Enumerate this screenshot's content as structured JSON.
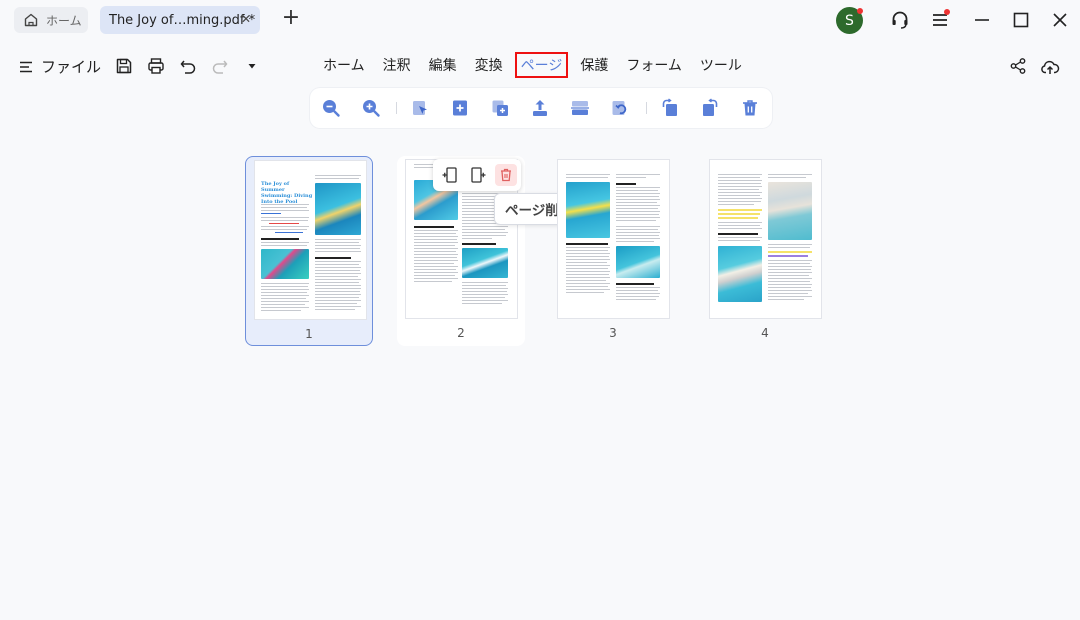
{
  "tabs": {
    "home_label": "ホーム",
    "doc_title": "The Joy of…ming.pdf *"
  },
  "user": {
    "avatar_initial": "S",
    "avatar_color": "#2d6a2c"
  },
  "menubar": {
    "file_label": "ファイル",
    "items": [
      "ホーム",
      "注釈",
      "編集",
      "変換",
      "ページ",
      "保護",
      "フォーム",
      "ツール"
    ],
    "active_index": 4
  },
  "page_tools": {
    "icons": [
      "zoom-out-icon",
      "zoom-in-icon",
      "select-page-icon",
      "insert-page-icon",
      "extract-page-icon",
      "export-page-icon",
      "split-page-icon",
      "replace-page-icon",
      "rotate-left-icon",
      "rotate-right-icon",
      "delete-page-icon"
    ]
  },
  "thumbnails": [
    {
      "number": "1",
      "selected": true,
      "title": "The Joy of Summer Swimming: Diving Into the Pool"
    },
    {
      "number": "2",
      "selected": false
    },
    {
      "number": "3",
      "selected": false
    },
    {
      "number": "4",
      "selected": false
    }
  ],
  "page_actions": {
    "tooltip": "ページ削除",
    "icons": [
      "insert-page-before-icon",
      "insert-page-after-icon",
      "delete-page-icon"
    ]
  },
  "colors": {
    "accent": "#5a7fd8",
    "highlight_box": "#e11111",
    "selection": "#6e8fdb"
  }
}
